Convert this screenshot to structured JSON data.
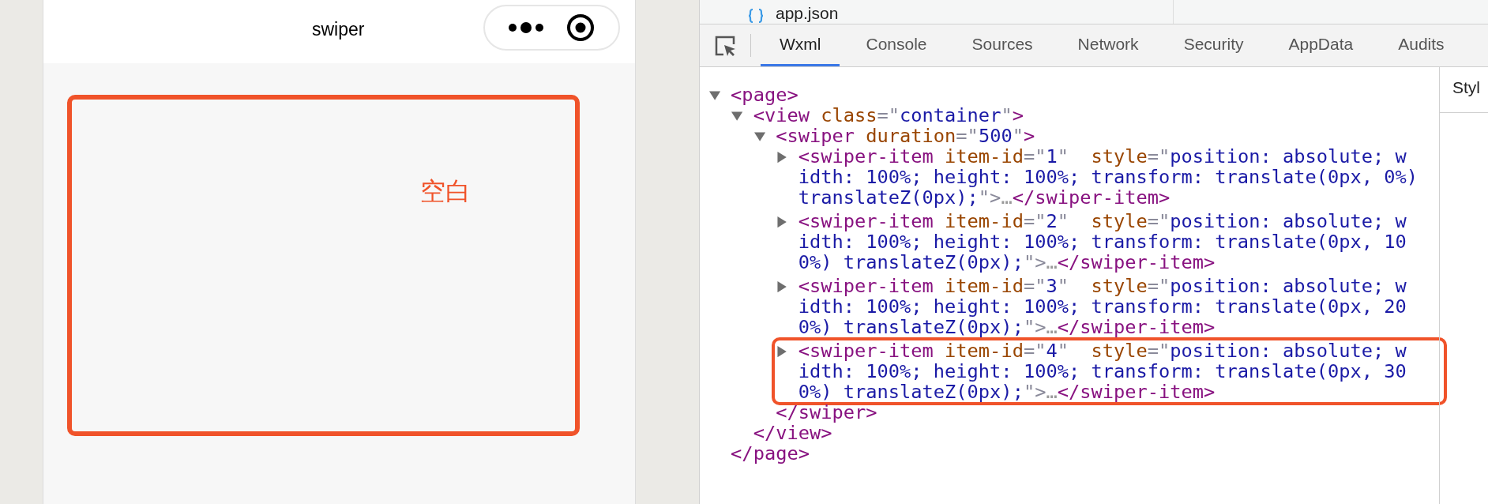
{
  "phone": {
    "title": "swiper",
    "annotation": {
      "label": "空白"
    }
  },
  "devtools": {
    "file_tab": {
      "label": "app.json"
    },
    "tabs": [
      {
        "label": "Wxml",
        "selected": true
      },
      {
        "label": "Console",
        "selected": false
      },
      {
        "label": "Sources",
        "selected": false
      },
      {
        "label": "Network",
        "selected": false
      },
      {
        "label": "Security",
        "selected": false
      },
      {
        "label": "AppData",
        "selected": false
      },
      {
        "label": "Audits",
        "selected": false
      }
    ],
    "side_panel": {
      "label": "Styl"
    },
    "tree": [
      {
        "expanded": true,
        "open": [
          {
            "kind": "tag",
            "text": "<page>"
          }
        ],
        "close": [
          {
            "kind": "tag",
            "text": "</page>"
          }
        ],
        "children": [
          {
            "expanded": true,
            "open": [
              {
                "kind": "tag",
                "text": "<view"
              },
              {
                "kind": "attr",
                "text": " class"
              },
              {
                "kind": "punct",
                "text": "=\""
              },
              {
                "kind": "value",
                "text": "container"
              },
              {
                "kind": "punct",
                "text": "\""
              },
              {
                "kind": "tag",
                "text": ">"
              }
            ],
            "close": [
              {
                "kind": "tag",
                "text": "</view>"
              }
            ],
            "children": [
              {
                "expanded": true,
                "open": [
                  {
                    "kind": "tag",
                    "text": "<swiper"
                  },
                  {
                    "kind": "attr",
                    "text": " duration"
                  },
                  {
                    "kind": "punct",
                    "text": "=\""
                  },
                  {
                    "kind": "value",
                    "text": "500"
                  },
                  {
                    "kind": "punct",
                    "text": "\""
                  },
                  {
                    "kind": "tag",
                    "text": ">"
                  }
                ],
                "close": [
                  {
                    "kind": "tag",
                    "text": "</swiper>"
                  }
                ],
                "children": [
                  {
                    "expanded": false,
                    "highlighted": false,
                    "open": [
                      {
                        "kind": "tag",
                        "text": "<swiper-item"
                      },
                      {
                        "kind": "attr",
                        "text": " item-id"
                      },
                      {
                        "kind": "punct",
                        "text": "=\""
                      },
                      {
                        "kind": "value",
                        "text": "1"
                      },
                      {
                        "kind": "punct",
                        "text": "\""
                      },
                      {
                        "kind": "attr",
                        "text": "  style"
                      },
                      {
                        "kind": "punct",
                        "text": "=\""
                      },
                      {
                        "kind": "value",
                        "text": "position: absolute; width: 100%; height: 100%; transform: translate(0px, 0%) translateZ(0px);"
                      },
                      {
                        "kind": "punct",
                        "text": "\">"
                      },
                      {
                        "kind": "ellipsis",
                        "text": "…"
                      },
                      {
                        "kind": "tag",
                        "text": "</swiper-item>"
                      }
                    ]
                  },
                  {
                    "expanded": false,
                    "highlighted": false,
                    "open": [
                      {
                        "kind": "tag",
                        "text": "<swiper-item"
                      },
                      {
                        "kind": "attr",
                        "text": " item-id"
                      },
                      {
                        "kind": "punct",
                        "text": "=\""
                      },
                      {
                        "kind": "value",
                        "text": "2"
                      },
                      {
                        "kind": "punct",
                        "text": "\""
                      },
                      {
                        "kind": "attr",
                        "text": "  style"
                      },
                      {
                        "kind": "punct",
                        "text": "=\""
                      },
                      {
                        "kind": "value",
                        "text": "position: absolute; width: 100%; height: 100%; transform: translate(0px, 100%) translateZ(0px);"
                      },
                      {
                        "kind": "punct",
                        "text": "\">"
                      },
                      {
                        "kind": "ellipsis",
                        "text": "…"
                      },
                      {
                        "kind": "tag",
                        "text": "</swiper-item>"
                      }
                    ]
                  },
                  {
                    "expanded": false,
                    "highlighted": false,
                    "open": [
                      {
                        "kind": "tag",
                        "text": "<swiper-item"
                      },
                      {
                        "kind": "attr",
                        "text": " item-id"
                      },
                      {
                        "kind": "punct",
                        "text": "=\""
                      },
                      {
                        "kind": "value",
                        "text": "3"
                      },
                      {
                        "kind": "punct",
                        "text": "\""
                      },
                      {
                        "kind": "attr",
                        "text": "  style"
                      },
                      {
                        "kind": "punct",
                        "text": "=\""
                      },
                      {
                        "kind": "value",
                        "text": "position: absolute; width: 100%; height: 100%; transform: translate(0px, 200%) translateZ(0px);"
                      },
                      {
                        "kind": "punct",
                        "text": "\">"
                      },
                      {
                        "kind": "ellipsis",
                        "text": "…"
                      },
                      {
                        "kind": "tag",
                        "text": "</swiper-item>"
                      }
                    ]
                  },
                  {
                    "expanded": false,
                    "highlighted": true,
                    "open": [
                      {
                        "kind": "tag",
                        "text": "<swiper-item"
                      },
                      {
                        "kind": "attr",
                        "text": " item-id"
                      },
                      {
                        "kind": "punct",
                        "text": "=\""
                      },
                      {
                        "kind": "value",
                        "text": "4"
                      },
                      {
                        "kind": "punct",
                        "text": "\""
                      },
                      {
                        "kind": "attr",
                        "text": "  style"
                      },
                      {
                        "kind": "punct",
                        "text": "=\""
                      },
                      {
                        "kind": "value",
                        "text": "position: absolute; width: 100%; height: 100%; transform: translate(0px, 300%) translateZ(0px);"
                      },
                      {
                        "kind": "punct",
                        "text": "\">"
                      },
                      {
                        "kind": "ellipsis",
                        "text": "…"
                      },
                      {
                        "kind": "tag",
                        "text": "</swiper-item>"
                      }
                    ]
                  }
                ]
              }
            ]
          }
        ]
      }
    ]
  }
}
